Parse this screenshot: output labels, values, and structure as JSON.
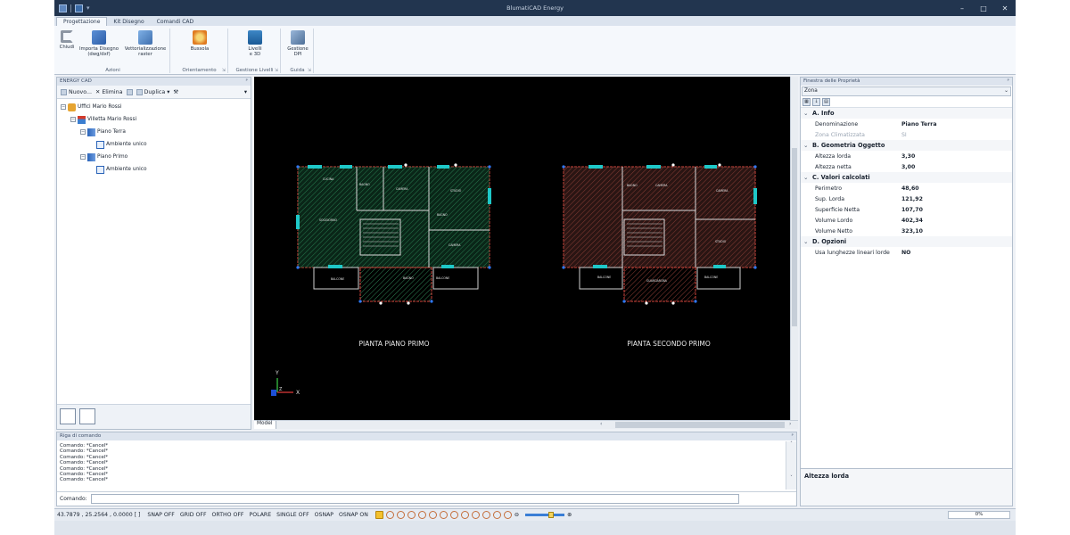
{
  "window": {
    "title": "BlumatiCAD Energy"
  },
  "ribbon": {
    "tabs": [
      {
        "label": "Progettazione",
        "active": true
      },
      {
        "label": "Kit Disegno",
        "active": false
      },
      {
        "label": "Comandi CAD",
        "active": false
      }
    ],
    "buttons": {
      "chiudi": "Chiudi",
      "importa_line1": "Importa Disegno",
      "importa_line2": "(dwg/dxf)",
      "vettor_line1": "Vettorializzazione",
      "vettor_line2": "raster",
      "bussola": "Bussola",
      "livelli_line1": "Livelli",
      "livelli_line2": "e 3D",
      "dpi_line1": "Gestione",
      "dpi_line2": "DPI"
    },
    "groups": {
      "azioni": "Azioni",
      "orientamento": "Orientamento",
      "gestione_livelli": "Gestione Livelli",
      "guida": "Guida"
    }
  },
  "left_panel": {
    "title": "ENERGY CAD",
    "toolbar": {
      "nuovo": "Nuovo...",
      "elimina": "Elimina",
      "duplica": "Duplica"
    },
    "tree": [
      {
        "label": "Uffici Mario Rossi"
      },
      {
        "label": "Villetta Mario Rossi"
      },
      {
        "label": "Piano Terra"
      },
      {
        "label": "Ambiente unico"
      },
      {
        "label": "Piano Primo"
      },
      {
        "label": "Ambiente unico"
      }
    ]
  },
  "viewport": {
    "plan_left_title": "PIANTA PIANO PRIMO",
    "plan_right_title": "PIANTA SECONDO PRIMO",
    "axis_y": "Y",
    "axis_x": "X",
    "axis_z": "Z",
    "model_tab": "Model",
    "rooms_left": [
      "CUCINA",
      "BAGNO",
      "CAMERA",
      "STUDIO",
      "SOGGIORNO",
      "BAGNO",
      "CAMERA",
      "BALCONE",
      "BAGNO",
      "BALCONE"
    ],
    "rooms_right": [
      "BAGNO",
      "CAMERA",
      "CAMERA",
      "STUDIO",
      "BALCONE",
      "GUARDAROBA",
      "BALCONE"
    ]
  },
  "properties": {
    "title": "Finestra delle Proprietà",
    "selector": "Zona",
    "categories": [
      {
        "label": "A. Info",
        "rows": [
          {
            "name": "Denominazione",
            "value": "Piano Terra",
            "disabled": false
          },
          {
            "name": "Zona Climatizzata",
            "value": "SI",
            "disabled": true
          }
        ]
      },
      {
        "label": "B. Geometria Oggetto",
        "rows": [
          {
            "name": "Altezza lorda",
            "value": "3,30",
            "disabled": false
          },
          {
            "name": "Altezza netta",
            "value": "3,00",
            "disabled": false
          }
        ]
      },
      {
        "label": "C. Valori calcolati",
        "rows": [
          {
            "name": "Perimetro",
            "value": "48,60",
            "disabled": false
          },
          {
            "name": "Sup. Lorda",
            "value": "121,92",
            "disabled": false
          },
          {
            "name": "Superficie Netta",
            "value": "107,70",
            "disabled": false
          },
          {
            "name": "Volume Lordo",
            "value": "402,34",
            "disabled": false
          },
          {
            "name": "Volume Netto",
            "value": "323,10",
            "disabled": false
          }
        ]
      },
      {
        "label": "D. Opzioni",
        "rows": [
          {
            "name": "Usa lunghezze lineari lorde",
            "value": "NO",
            "disabled": false
          }
        ]
      }
    ],
    "description": "Altezza lorda"
  },
  "command": {
    "title": "Riga di comando",
    "log": [
      "Comando: *Cancel*",
      "Comando: *Cancel*",
      "Comando: *Cancel*",
      "Comando: *Cancel*",
      "Comando: *Cancel*",
      "Comando: *Cancel*",
      "Comando: *Cancel*"
    ],
    "prompt": "Comando:",
    "value": ""
  },
  "status": {
    "coords": "43.7879 , 25.2564 , 0.0000 [ ]",
    "toggles": [
      "SNAP OFF",
      "GRID OFF",
      "ORTHO OFF",
      "POLARE",
      "SINGLE OFF",
      "OSNAP",
      "OSNAP ON"
    ],
    "progress": "0%"
  },
  "colors": {
    "titlebar": "#22354f",
    "accent": "#2a63b8",
    "viewport_bg": "#000000"
  }
}
